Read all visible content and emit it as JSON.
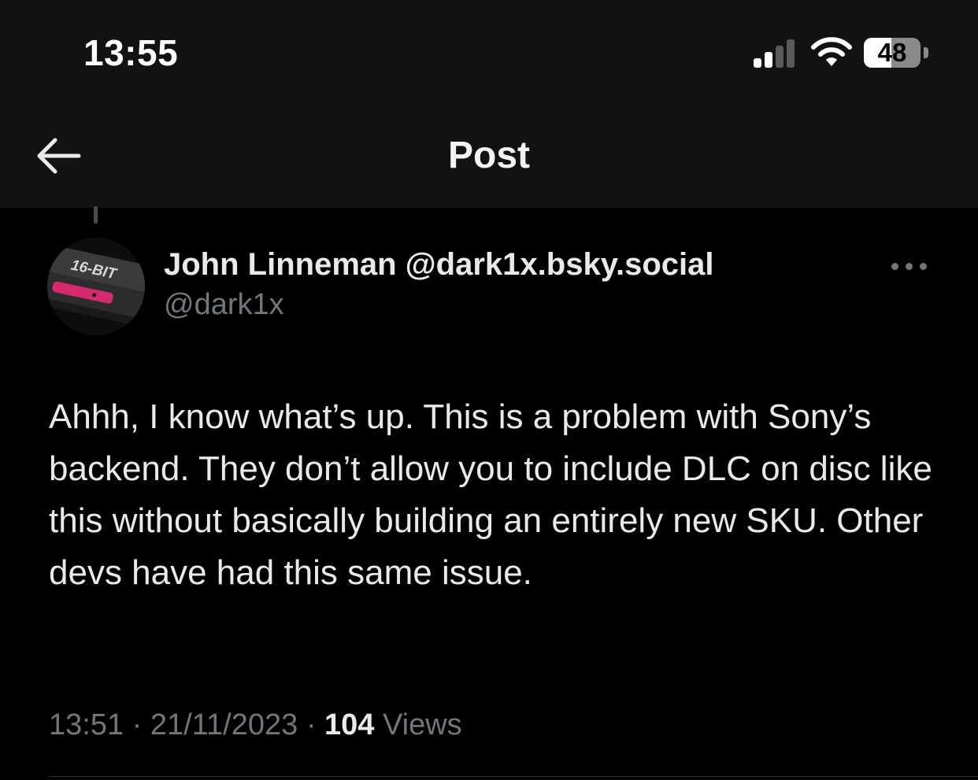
{
  "status_bar": {
    "time": "13:55",
    "battery_percent": "48",
    "battery_level": 0.48,
    "signal_bars_active": 2,
    "signal_bars_total": 4
  },
  "nav": {
    "title": "Post",
    "back_icon": "arrow-left-icon"
  },
  "post": {
    "avatar_text": "16-BIT",
    "author_name": "John Linneman @dark1x.bsky.social",
    "author_handle": "@dark1x",
    "more_icon": "more-horizontal-icon",
    "body": "Ahhh, I know what’s up. This is a problem with Sony’s backend. They don’t allow you to include DLC on disc like this without basically building an entirely new SKU. Other devs have had this same issue.",
    "time": "13:51",
    "date": "21/11/2023",
    "separator": "·",
    "views_count": "104",
    "views_label": "Views"
  },
  "colors": {
    "background": "#000000",
    "header_background": "#121212",
    "text_primary": "#e7e9ea",
    "text_secondary": "#71767b",
    "avatar_accent": "#d42a6e"
  }
}
